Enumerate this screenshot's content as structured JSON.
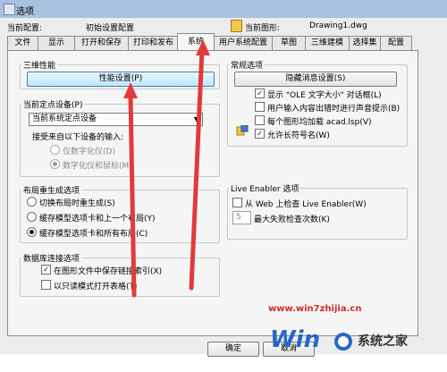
{
  "window": {
    "title": "选项"
  },
  "header": {
    "profile_label": "当前配置:",
    "profile_value": "初始设置配置",
    "drawing_label": "当前图形:",
    "drawing_value": "Drawing1.dwg"
  },
  "tabs": [
    {
      "label": "文件"
    },
    {
      "label": "显示"
    },
    {
      "label": "打开和保存"
    },
    {
      "label": "打印和发布"
    },
    {
      "label": "系统"
    },
    {
      "label": "用户系统配置"
    },
    {
      "label": "草图"
    },
    {
      "label": "三维建模"
    },
    {
      "label": "选择集"
    },
    {
      "label": "配置"
    }
  ],
  "active_tab": "系统",
  "performance": {
    "group_title": "三维性能",
    "button_label": "性能设置(P)"
  },
  "pointing_device": {
    "group_title": "当前定点设备(P)",
    "selected": "当前系统定点设备",
    "accept_label": "接受来自以下设备的输入:",
    "options": [
      {
        "label": "仅数字化仪(D)",
        "checked": false,
        "enabled": false
      },
      {
        "label": "数字化仪和鼠标(M)",
        "checked": true,
        "enabled": false
      }
    ]
  },
  "layout_regen": {
    "group_title": "布局重生成选项",
    "options": [
      {
        "label": "切换布局时重生成(S)",
        "checked": false
      },
      {
        "label": "缓存模型选项卡和上一个布局(Y)",
        "checked": false
      },
      {
        "label": "缓存模型选项卡和所有布局(C)",
        "checked": true
      }
    ]
  },
  "db_connect": {
    "group_title": "数据库连接选项",
    "options": [
      {
        "label": "在图形文件中保存链接索引(X)",
        "checked": true
      },
      {
        "label": "以只读模式打开表格(T)",
        "checked": false
      }
    ]
  },
  "general": {
    "group_title": "常规选项",
    "button_label": "隐藏消息设置(S)",
    "options": [
      {
        "label": "显示 \"OLE 文字大小\" 对话框(L)",
        "checked": true
      },
      {
        "label": "用户输入内容出错时进行声音提示(B)",
        "checked": false
      },
      {
        "label": "每个图形均加载 acad.lsp(V)",
        "checked": false
      },
      {
        "label": "允许长符号名(W)",
        "checked": true
      }
    ]
  },
  "live_enabler": {
    "group_title": "Live Enabler 选项",
    "check_label": "从 Web 上检查 Live Enabler(W)",
    "checked": false,
    "max_fail_value": "5",
    "max_fail_label": "最大失败检查次数(K)"
  },
  "footer": {
    "ok_label": "确定",
    "cancel_label": "取消"
  },
  "watermark": {
    "site": "www.win7zhijia.cn",
    "brand": "系统之家"
  },
  "colors": {
    "annotation_arrow": "#e23a3a",
    "titlebar": "#a9c1de"
  }
}
